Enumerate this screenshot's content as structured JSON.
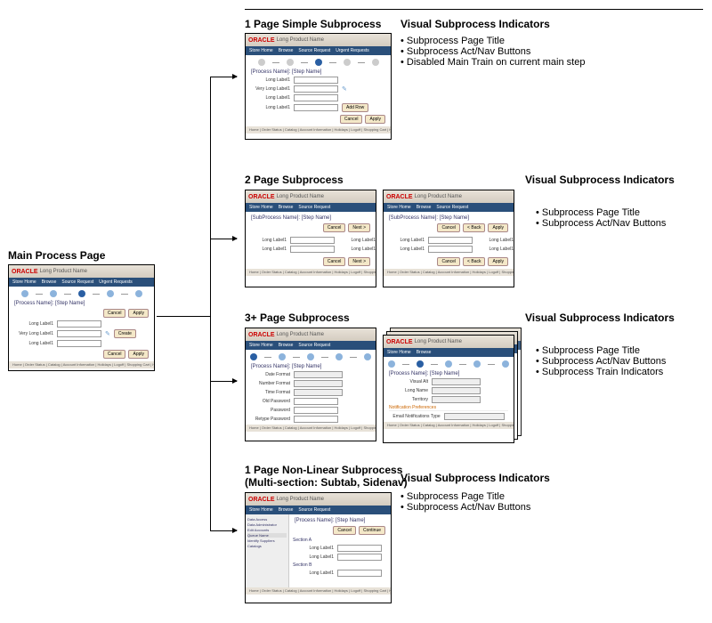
{
  "main_label": "Main Process Page",
  "sections": {
    "s1": {
      "title": "1 Page Simple Subprocess",
      "vsi_title": "Visual Subprocess Indicators",
      "indicators": [
        "Subprocess Page Title",
        "Subprocess Act/Nav Buttons",
        "Disabled Main Train on current main step"
      ]
    },
    "s2": {
      "title": "2 Page Subprocess",
      "vsi_title": "Visual Subprocess Indicators",
      "indicators": [
        "Subprocess Page Title",
        "Subprocess Act/Nav Buttons"
      ]
    },
    "s3": {
      "title": "3+ Page Subprocess",
      "vsi_title": "Visual Subprocess Indicators",
      "indicators": [
        "Subprocess Page Title",
        "Subprocess Act/Nav Buttons",
        "Subprocess Train Indicators"
      ]
    },
    "s4": {
      "title": "1 Page Non-Linear Subprocess",
      "subtitle": "(Multi-section: Subtab, Sidenav)",
      "vsi_title": "Visual Subprocess Indicators",
      "indicators": [
        "Subprocess Page Title",
        "Subprocess Act/Nav Buttons"
      ]
    }
  },
  "thumb": {
    "oracle": "ORACLE",
    "product": "Long Product Name",
    "nav": [
      "Store Home",
      "Browse",
      "Source Request",
      "Urgent Requests"
    ],
    "page_title": "[Process Name]: [Step Name]",
    "sub_page_title": "[SubProcess Name]: [Step Name]",
    "labels": {
      "long": "Long Label1",
      "verylong": "Very Long Label1"
    },
    "form3": {
      "date": "Date Format",
      "number": "Number Format",
      "time": "Time Format",
      "oldpw": "Old Password",
      "pw": "Password",
      "confirm": "Retype Password"
    },
    "form3b": {
      "displayas": "Visual Alt",
      "longname": "Long Name",
      "territory": "Territory",
      "pref_hdr": "Notification Preferences",
      "pref_label": "Email Notifications Type"
    },
    "sidenav": [
      "Data Access",
      "Data Administrator",
      "Edit Accounts",
      "Queue Name",
      "Identify Suppliers",
      "Catalogs"
    ],
    "section_a": "Section A",
    "section_b": "Section B",
    "buttons": {
      "cancel": "Cancel",
      "apply": "Apply",
      "create": "Create",
      "next": "Next >",
      "back": "< Back",
      "addrow": "Add Row",
      "continue": "Continue"
    },
    "footer": "Home | Order Status | Catalog | Account Information | Holidays | Logoff | Shopping Cart | Help"
  }
}
